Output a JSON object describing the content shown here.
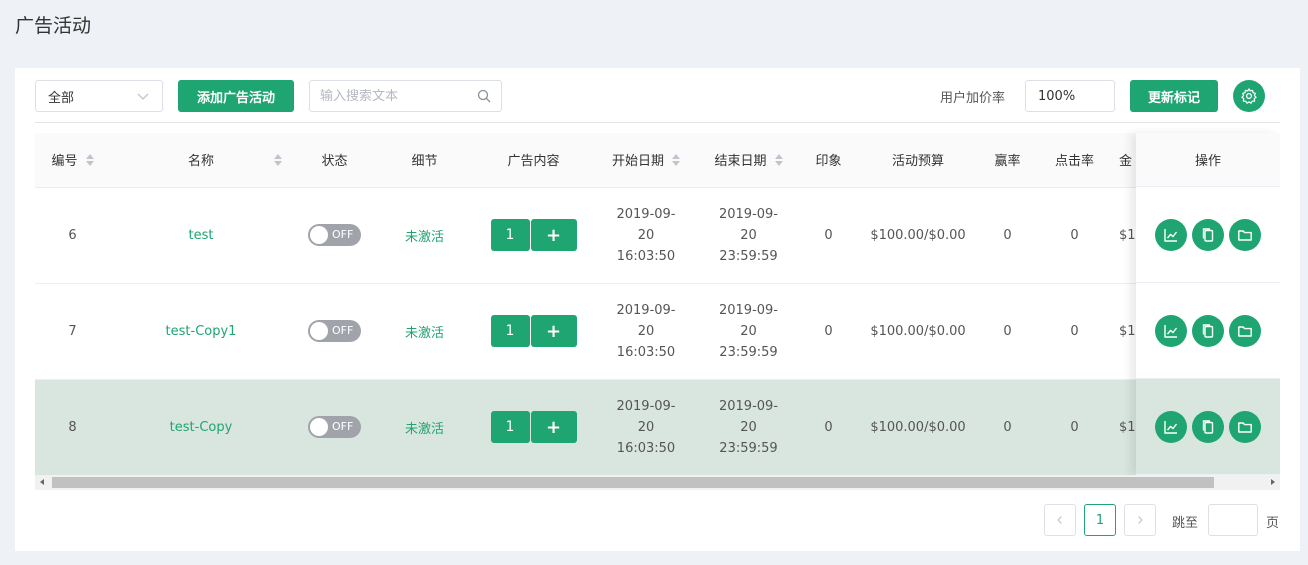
{
  "page": {
    "title": "广告活动"
  },
  "toolbar": {
    "filter_value": "全部",
    "add_label": "添加广告活动",
    "search_placeholder": "输入搜索文本",
    "markup_label": "用户加价率",
    "markup_value": "100%",
    "update_label": "更新标记"
  },
  "table": {
    "headers": {
      "id": "编号",
      "name": "名称",
      "status": "状态",
      "detail": "细节",
      "content": "广告内容",
      "start": "开始日期",
      "end": "结束日期",
      "impressions": "印象",
      "budget": "活动预算",
      "win_rate": "赢率",
      "ctr": "点击率",
      "clipped": "金",
      "actions": "操作"
    },
    "rows": [
      {
        "id": "6",
        "name": "test",
        "status": "OFF",
        "detail": "未激活",
        "content_count": "1",
        "add": "+",
        "start": [
          "2019-09-",
          "20",
          "16:03:50"
        ],
        "end": [
          "2019-09-",
          "20",
          "23:59:59"
        ],
        "impressions": "0",
        "budget": "$100.00/$0.00",
        "win_rate": "0",
        "ctr": "0",
        "clipped": "$1"
      },
      {
        "id": "7",
        "name": "test-Copy1",
        "status": "OFF",
        "detail": "未激活",
        "content_count": "1",
        "add": "+",
        "start": [
          "2019-09-",
          "20",
          "16:03:50"
        ],
        "end": [
          "2019-09-",
          "20",
          "23:59:59"
        ],
        "impressions": "0",
        "budget": "$100.00/$0.00",
        "win_rate": "0",
        "ctr": "0",
        "clipped": "$1"
      },
      {
        "id": "8",
        "name": "test-Copy",
        "status": "OFF",
        "detail": "未激活",
        "content_count": "1",
        "add": "+",
        "start": [
          "2019-09-",
          "20",
          "16:03:50"
        ],
        "end": [
          "2019-09-",
          "20",
          "23:59:59"
        ],
        "impressions": "0",
        "budget": "$100.00/$0.00",
        "win_rate": "0",
        "ctr": "0",
        "clipped": "$1",
        "selected": true
      }
    ]
  },
  "pagination": {
    "current": "1",
    "jump_label": "跳至",
    "suffix": "页"
  },
  "colors": {
    "accent": "#1fa572",
    "selected_row": "#d8e6df",
    "background": "#eef1f5"
  },
  "icons": {
    "select": "chevron-down-icon",
    "search": "search-icon",
    "settings": "gear-icon",
    "stats": "line-chart-icon",
    "copy": "copy-icon",
    "folder": "folder-icon",
    "prev": "chevron-left-icon",
    "next": "chevron-right-icon"
  }
}
